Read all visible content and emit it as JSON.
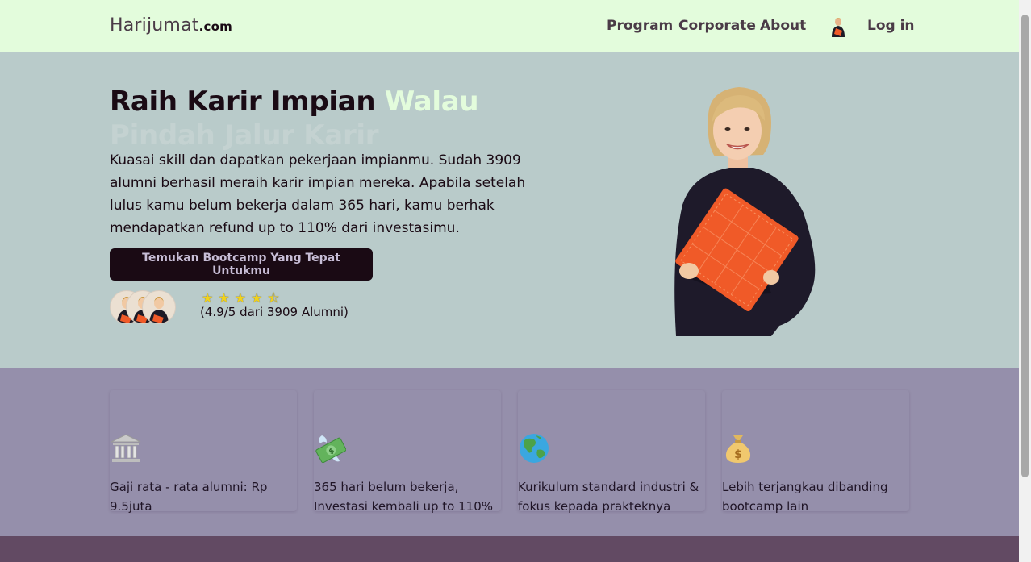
{
  "navbar": {
    "brand": {
      "name": "Harijumat",
      "suffix": ".com"
    },
    "links": [
      "Program",
      "Corporate",
      "About"
    ],
    "login_label": "Log in",
    "avatar_icon": "user-avatar-icon"
  },
  "hero": {
    "title_main": "Raih Karir Impian ",
    "title_accent": "Walau",
    "title_sub": "Pindah Jalur Karir",
    "description": "Kuasai skill dan dapatkan pekerjaan impianmu. Sudah 3909 alumni berhasil meraih karir impian mereka. Apabila setelah lulus kamu belum bekerja dalam 365 hari, kamu berhak mendapatkan refund up to 110% dari investasimu.",
    "cta_label": "Temukan Bootcamp Yang Tepat Untukmu",
    "stars": "★★★★⯪",
    "rating_value": 4.5,
    "rating_text": "(4.9/5 dari 3909 Alumni)"
  },
  "features": [
    {
      "icon": "bank-icon",
      "text": "Gaji rata - rata alumni: Rp 9.5juta"
    },
    {
      "icon": "money-wings-icon",
      "text": "365 hari belum bekerja, Investasi kembali up to 110%"
    },
    {
      "icon": "globe-icon",
      "text": "Kurikulum standard industri & fokus kepada prakteknya"
    },
    {
      "icon": "money-bag-icon",
      "text": "Lebih terjangkau dibanding bootcamp lain"
    }
  ],
  "colors": {
    "navbar_bg": "#e3fcdc",
    "hero_bg": "#b9cbca",
    "features_bg": "#958fab",
    "footer_bg": "#624a63",
    "cta_bg": "#1a0a14",
    "accent": "#e3fcdc",
    "book_orange": "#f05a28"
  }
}
